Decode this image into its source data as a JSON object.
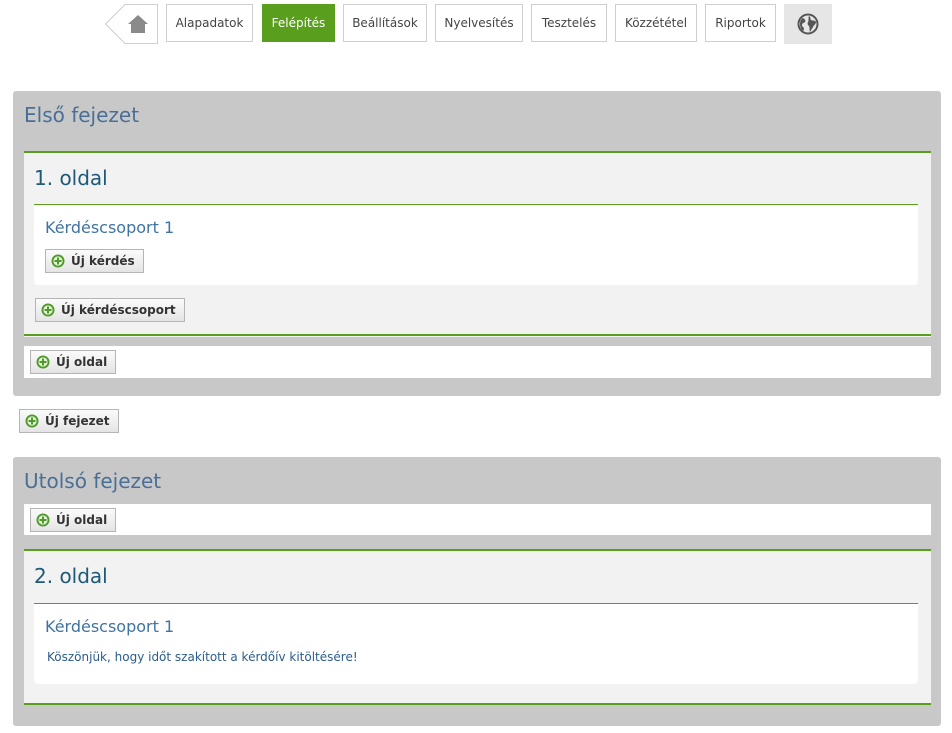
{
  "nav": {
    "tabs": [
      {
        "label": "Alapadatok",
        "active": false
      },
      {
        "label": "Felépítés",
        "active": true
      },
      {
        "label": "Beállítások",
        "active": false
      },
      {
        "label": "Nyelvesítés",
        "active": false
      },
      {
        "label": "Tesztelés",
        "active": false
      },
      {
        "label": "Közzététel",
        "active": false
      },
      {
        "label": "Riportok",
        "active": false
      }
    ],
    "home_icon": "home-icon",
    "globe_icon": "globe-icon"
  },
  "colors": {
    "accent_green": "#5a9e1e",
    "chapter_bg": "#c8c8c8",
    "chapter_title": "#4a6f96",
    "page_title": "#1e5a78",
    "group_title": "#3f73a3"
  },
  "chapters": [
    {
      "title": "Első fejezet",
      "pages": [
        {
          "title": "1. oldal",
          "groups": [
            {
              "title": "Kérdéscsoport 1",
              "add_question_label": "Új kérdés"
            }
          ],
          "add_group_label": "Új kérdéscsoport"
        }
      ],
      "add_page_label": "Új oldal"
    },
    {
      "title": "Utolsó fejezet",
      "add_page_label": "Új oldal",
      "pages": [
        {
          "title": "2. oldal",
          "groups": [
            {
              "title": "Kérdéscsoport 1",
              "text": "Köszönjük, hogy időt szakított a kérdőív kitöltésére!"
            }
          ]
        }
      ]
    }
  ],
  "add_chapter_label": "Új fejezet"
}
